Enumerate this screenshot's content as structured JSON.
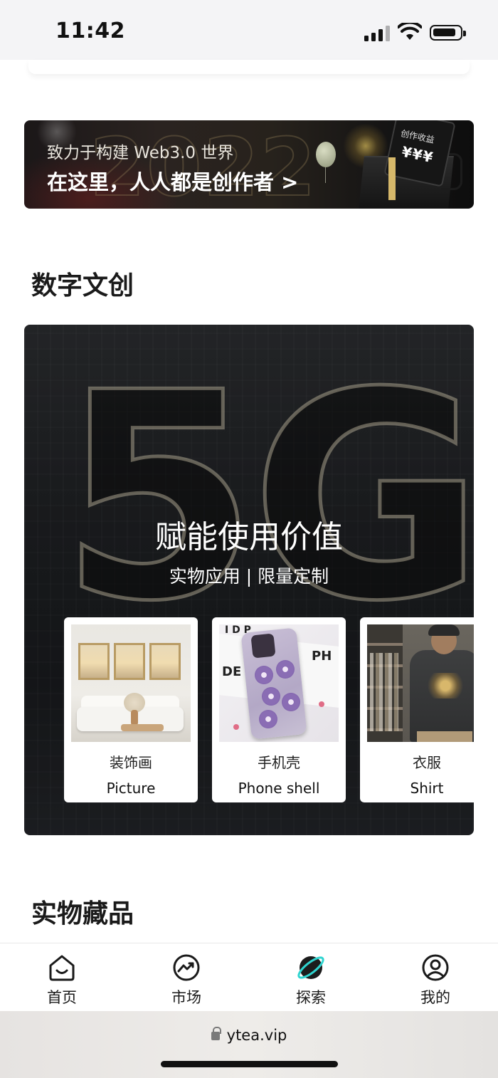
{
  "status_bar": {
    "time": "11:42",
    "icons": [
      "cellular-signal-icon",
      "wifi-icon",
      "battery-icon"
    ]
  },
  "banner": {
    "line1": "致力于构建 Web3.0 世界",
    "line2": "在这里，人人都是创作者 >",
    "ticket_title": "创作收益",
    "ticket_amount": "¥¥¥"
  },
  "section_digital": {
    "title": "数字文创"
  },
  "hero": {
    "title": "赋能使用价值",
    "subtitle": "实物应用 | 限量定制",
    "cards": [
      {
        "cn": "装饰画",
        "en": "Picture"
      },
      {
        "cn": "手机壳",
        "en": "Phone shell"
      },
      {
        "cn": "衣服",
        "en": "Shirt"
      }
    ]
  },
  "section_physical": {
    "title": "实物藏品"
  },
  "tabbar": {
    "items": [
      {
        "label": "首页",
        "icon": "home-icon"
      },
      {
        "label": "市场",
        "icon": "market-trend-icon"
      },
      {
        "label": "探索",
        "icon": "explore-planet-icon",
        "active": true
      },
      {
        "label": "我的",
        "icon": "profile-icon"
      }
    ]
  },
  "browser": {
    "url": "ytea.vip"
  },
  "colors": {
    "accent": "#2fd4d0",
    "text": "#1a1a1a",
    "hero_bg": "#1f2124"
  }
}
